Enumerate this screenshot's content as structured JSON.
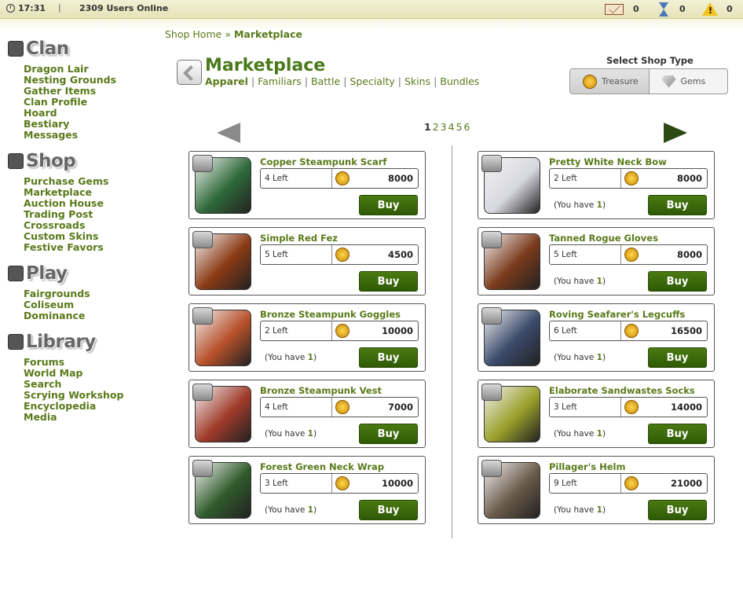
{
  "topbar": {
    "time": "17:31",
    "separator": "|",
    "users_online": "2309 Users Online",
    "mail_count": "0",
    "hourglass_count": "0",
    "alert_count": "0"
  },
  "sidebar": {
    "sections": [
      {
        "title": "Clan",
        "icon": "home-icon",
        "items": [
          "Dragon Lair",
          "Nesting Grounds",
          "Gather Items",
          "Clan Profile",
          "Hoard",
          "Bestiary",
          "Messages"
        ]
      },
      {
        "title": "Shop",
        "icon": "shop-icon",
        "items": [
          "Purchase Gems",
          "Marketplace",
          "Auction House",
          "Trading Post",
          "Crossroads",
          "Custom Skins",
          "Festive Favors"
        ]
      },
      {
        "title": "Play",
        "icon": "play-icon",
        "items": [
          "Fairgrounds",
          "Coliseum",
          "Dominance"
        ]
      },
      {
        "title": "Library",
        "icon": "book-icon",
        "items": [
          "Forums",
          "World Map",
          "Search",
          "Scrying Workshop",
          "Encyclopedia",
          "Media"
        ]
      }
    ]
  },
  "breadcrumb": {
    "home": "Shop Home",
    "sep": "»",
    "current": "Marketplace"
  },
  "page_title": "Marketplace",
  "subnav": [
    "Apparel",
    "Familiars",
    "Battle",
    "Specialty",
    "Skins",
    "Bundles"
  ],
  "shop_type": {
    "label": "Select Shop Type",
    "treasure": "Treasure",
    "gems": "Gems"
  },
  "pagination": {
    "pages": [
      "1",
      "2",
      "3",
      "4",
      "5",
      "6"
    ],
    "current": "1"
  },
  "items_left": [
    {
      "name": "Copper Steampunk Scarf",
      "stock": "4 Left",
      "price": "8000",
      "you_have": "",
      "thumb": "#2f6a3a"
    },
    {
      "name": "Simple Red Fez",
      "stock": "5 Left",
      "price": "4500",
      "you_have": "",
      "thumb": "#8a3a14"
    },
    {
      "name": "Bronze Steampunk Goggles",
      "stock": "2 Left",
      "price": "10000",
      "you_have": "1",
      "thumb": "#b8502a"
    },
    {
      "name": "Bronze Steampunk Vest",
      "stock": "4 Left",
      "price": "7000",
      "you_have": "1",
      "thumb": "#a03a2a"
    },
    {
      "name": "Forest Green Neck Wrap",
      "stock": "3 Left",
      "price": "10000",
      "you_have": "1",
      "thumb": "#2f5a2a"
    }
  ],
  "items_right": [
    {
      "name": "Pretty White Neck Bow",
      "stock": "2 Left",
      "price": "8000",
      "you_have": "1",
      "thumb": "#d8d8e0"
    },
    {
      "name": "Tanned Rogue Gloves",
      "stock": "5 Left",
      "price": "8000",
      "you_have": "1",
      "thumb": "#7a3a1a"
    },
    {
      "name": "Roving Seafarer's Legcuffs",
      "stock": "6 Left",
      "price": "16500",
      "you_have": "1",
      "thumb": "#3a4a6a"
    },
    {
      "name": "Elaborate Sandwastes Socks",
      "stock": "3 Left",
      "price": "14000",
      "you_have": "1",
      "thumb": "#9aa02a"
    },
    {
      "name": "Pillager's Helm",
      "stock": "9 Left",
      "price": "21000",
      "you_have": "1",
      "thumb": "#6a5a4a"
    }
  ],
  "labels": {
    "buy": "Buy",
    "you_have_prefix": "(You have ",
    "you_have_suffix": ")"
  }
}
